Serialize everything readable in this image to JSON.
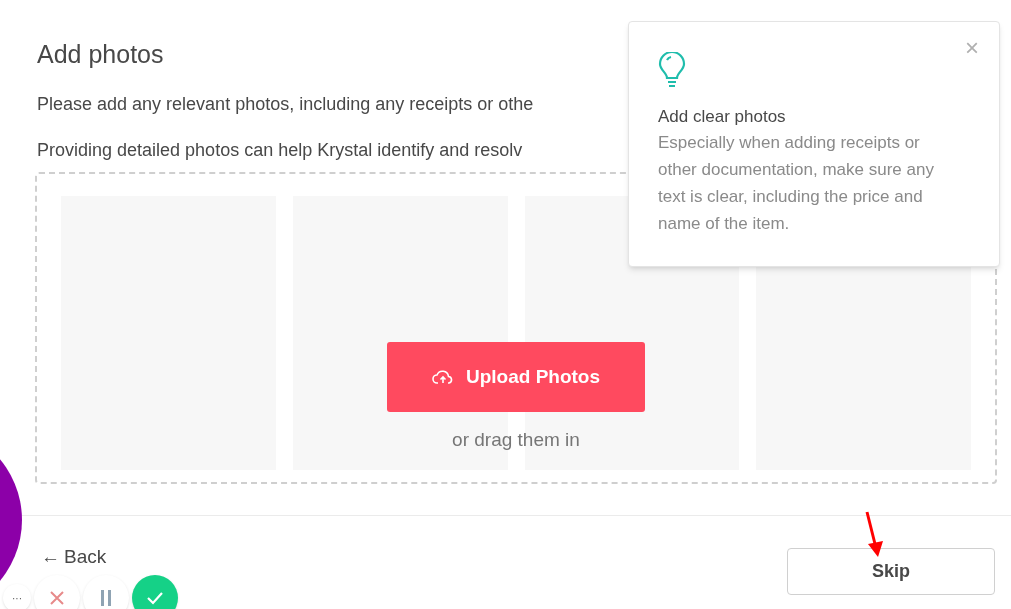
{
  "title": "Add photos",
  "paragraphs": [
    "Please add any relevant photos, including any receipts or othe",
    "Providing detailed photos can help Krystal identify and resolv"
  ],
  "dropzone": {
    "upload_button": "Upload Photos",
    "hint": "or drag them in"
  },
  "tip": {
    "title": "Add clear photos",
    "body": "Especially when adding receipts or other documentation, make sure any text is clear, including the price and name of the item.",
    "close": "×"
  },
  "footer": {
    "back": "Back",
    "back_arrow": "←",
    "skip": "Skip"
  },
  "recorder": {
    "more": "···"
  }
}
